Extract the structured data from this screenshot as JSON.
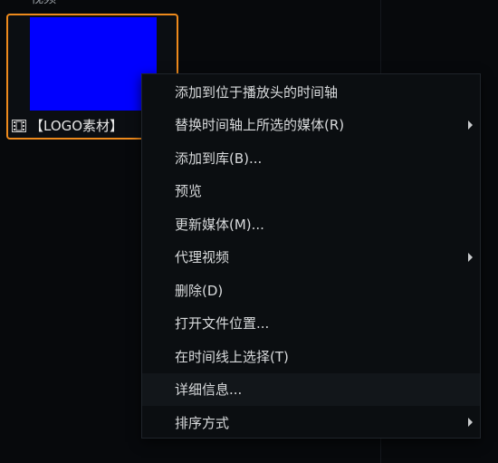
{
  "section": {
    "header": "视频"
  },
  "media_item": {
    "label": "【LOGO素材】",
    "thumbnail_color": "#0000ff",
    "selection_color": "#ee8a1c",
    "type_icon": "film-icon"
  },
  "context_menu": {
    "items": [
      {
        "label": "添加到位于播放头的时间轴",
        "submenu": false
      },
      {
        "label": "替换时间轴上所选的媒体(R)",
        "submenu": true
      },
      {
        "label": "添加到库(B)...",
        "submenu": false
      },
      {
        "label": "预览",
        "submenu": false
      },
      {
        "label": "更新媒体(M)...",
        "submenu": false
      },
      {
        "label": "代理视频",
        "submenu": true
      },
      {
        "label": "删除(D)",
        "submenu": false
      },
      {
        "label": "打开文件位置...",
        "submenu": false
      },
      {
        "label": "在时间线上选择(T)",
        "submenu": false
      },
      {
        "label": "详细信息...",
        "submenu": false,
        "hovered": true
      },
      {
        "label": "排序方式",
        "submenu": true
      }
    ]
  }
}
